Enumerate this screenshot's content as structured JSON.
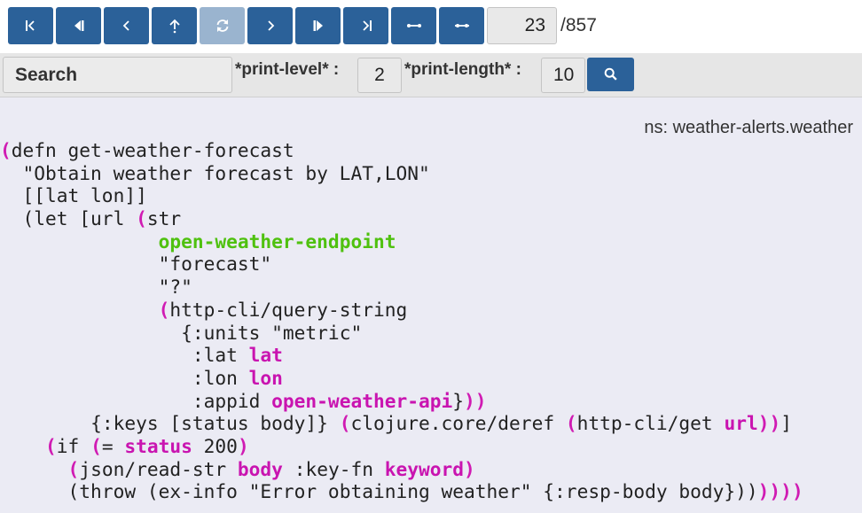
{
  "toolbar": {
    "buttons": [
      {
        "name": "first-step-button",
        "icon": "skip-to-first-icon",
        "enabled": true
      },
      {
        "name": "prev-step-back-button",
        "icon": "step-back-icon",
        "enabled": true
      },
      {
        "name": "prev-button",
        "icon": "chevron-left-icon",
        "enabled": true
      },
      {
        "name": "step-out-button",
        "icon": "arrow-up-icon",
        "enabled": true
      },
      {
        "name": "reload-button",
        "icon": "refresh-icon",
        "enabled": false
      },
      {
        "name": "next-button",
        "icon": "chevron-right-icon",
        "enabled": true
      },
      {
        "name": "step-over-button",
        "icon": "step-forward-icon",
        "enabled": true
      },
      {
        "name": "last-step-button",
        "icon": "skip-to-last-icon",
        "enabled": true
      },
      {
        "name": "collapse-button",
        "icon": "collapse-horizontal-icon",
        "enabled": true
      },
      {
        "name": "expand-button",
        "icon": "expand-horizontal-icon",
        "enabled": true
      }
    ],
    "current_step": "23",
    "total_steps": "/857",
    "accent_color": "#2b6199"
  },
  "search": {
    "placeholder": "Search",
    "print_level_label": "*print-level* :",
    "print_level_value": "2",
    "print_length_label": "*print-length* :",
    "print_length_value": "10",
    "search_button_icon": "search-icon"
  },
  "code_view": {
    "namespace": "ns: weather-alerts.weather",
    "highlight_color": "#d01bb3",
    "global_color": "#4fc10f",
    "lines": [
      {
        "indent": "",
        "segs": [
          [
            "p",
            "("
          ],
          [
            "t",
            "defn get-weather-forecast"
          ]
        ]
      },
      {
        "indent": "  ",
        "segs": [
          [
            "t",
            "\"Obtain weather forecast by LAT,LON\""
          ]
        ]
      },
      {
        "indent": "  ",
        "segs": [
          [
            "t",
            "[[lat lon]]"
          ]
        ]
      },
      {
        "indent": "  ",
        "segs": [
          [
            "t",
            "(let [url "
          ],
          [
            "p",
            "("
          ],
          [
            "t",
            "str"
          ]
        ]
      },
      {
        "indent": "              ",
        "segs": [
          [
            "g",
            "open-weather-endpoint"
          ]
        ]
      },
      {
        "indent": "              ",
        "segs": [
          [
            "t",
            "\"forecast\""
          ]
        ]
      },
      {
        "indent": "              ",
        "segs": [
          [
            "t",
            "\"?\""
          ]
        ]
      },
      {
        "indent": "              ",
        "segs": [
          [
            "p",
            "("
          ],
          [
            "t",
            "http-cli/query-string"
          ]
        ]
      },
      {
        "indent": "                ",
        "segs": [
          [
            "t",
            "{:units \"metric\""
          ]
        ]
      },
      {
        "indent": "                 ",
        "segs": [
          [
            "t",
            ":lat "
          ],
          [
            "m",
            "lat"
          ]
        ]
      },
      {
        "indent": "                 ",
        "segs": [
          [
            "t",
            ":lon "
          ],
          [
            "m",
            "lon"
          ]
        ]
      },
      {
        "indent": "                 ",
        "segs": [
          [
            "t",
            ":appid "
          ],
          [
            "m",
            "open-weather-api"
          ],
          [
            "t",
            "}"
          ],
          [
            "p",
            "))"
          ]
        ]
      },
      {
        "indent": "        ",
        "segs": [
          [
            "t",
            "{:keys [status body]} "
          ],
          [
            "p",
            "("
          ],
          [
            "t",
            "clojure.core/deref "
          ],
          [
            "p",
            "("
          ],
          [
            "t",
            "http-cli/get "
          ],
          [
            "m",
            "url"
          ],
          [
            "p",
            "))"
          ],
          [
            "t",
            "]"
          ]
        ]
      },
      {
        "indent": "    ",
        "segs": [
          [
            "p",
            "("
          ],
          [
            "t",
            "if "
          ],
          [
            "p",
            "("
          ],
          [
            "t",
            "= "
          ],
          [
            "m",
            "status"
          ],
          [
            "t",
            " 200"
          ],
          [
            "p",
            ")"
          ]
        ]
      },
      {
        "indent": "      ",
        "segs": [
          [
            "p",
            "("
          ],
          [
            "t",
            "json/read-str "
          ],
          [
            "m",
            "body"
          ],
          [
            "t",
            " :key-fn "
          ],
          [
            "m",
            "keyword"
          ],
          [
            "p",
            ")"
          ]
        ]
      },
      {
        "indent": "      ",
        "segs": [
          [
            "t",
            "(throw (ex-info \"Error obtaining weather\" {:resp-body body}))"
          ],
          [
            "p",
            "))))"
          ]
        ]
      }
    ]
  }
}
